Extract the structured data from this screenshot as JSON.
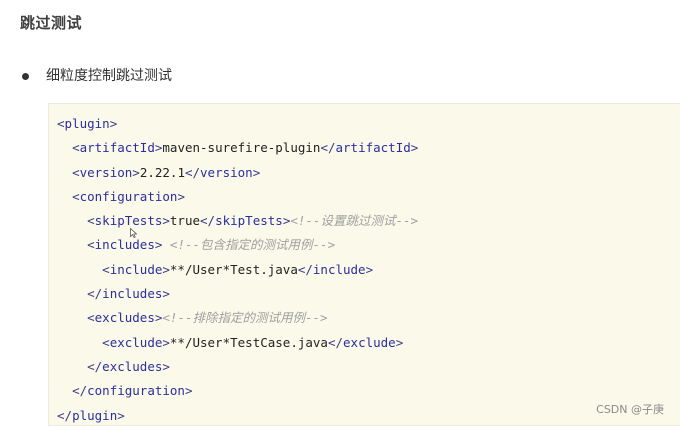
{
  "heading": "跳过测试",
  "bullet": {
    "text": "细粒度控制跳过测试"
  },
  "code": {
    "lines": [
      {
        "indent": "",
        "parts": [
          {
            "t": "tag",
            "v": "<"
          },
          {
            "t": "tagname",
            "v": "plugin"
          },
          {
            "t": "tag",
            "v": ">"
          }
        ]
      },
      {
        "indent": "  ",
        "parts": [
          {
            "t": "tag",
            "v": "<"
          },
          {
            "t": "tagname",
            "v": "artifactId"
          },
          {
            "t": "tag",
            "v": ">"
          },
          {
            "t": "text",
            "v": "maven-surefire-plugin"
          },
          {
            "t": "tag",
            "v": "</"
          },
          {
            "t": "tagname",
            "v": "artifactId"
          },
          {
            "t": "tag",
            "v": ">"
          }
        ]
      },
      {
        "indent": "  ",
        "parts": [
          {
            "t": "tag",
            "v": "<"
          },
          {
            "t": "tagname",
            "v": "version"
          },
          {
            "t": "tag",
            "v": ">"
          },
          {
            "t": "text",
            "v": "2.22.1"
          },
          {
            "t": "tag",
            "v": "</"
          },
          {
            "t": "tagname",
            "v": "version"
          },
          {
            "t": "tag",
            "v": ">"
          }
        ]
      },
      {
        "indent": "  ",
        "parts": [
          {
            "t": "tag",
            "v": "<"
          },
          {
            "t": "tagname",
            "v": "configuration"
          },
          {
            "t": "tag",
            "v": ">"
          }
        ]
      },
      {
        "indent": "    ",
        "parts": [
          {
            "t": "tag",
            "v": "<"
          },
          {
            "t": "tagname",
            "v": "skipTests"
          },
          {
            "t": "tag",
            "v": ">"
          },
          {
            "t": "text",
            "v": "true"
          },
          {
            "t": "tag",
            "v": "</"
          },
          {
            "t": "tagname",
            "v": "skipTests"
          },
          {
            "t": "tag",
            "v": ">"
          },
          {
            "t": "comment",
            "v": "<!--设置跳过测试-->"
          }
        ]
      },
      {
        "indent": "    ",
        "parts": [
          {
            "t": "tag",
            "v": "<"
          },
          {
            "t": "tagname",
            "v": "includes"
          },
          {
            "t": "tag",
            "v": ">"
          },
          {
            "t": "text",
            "v": " "
          },
          {
            "t": "comment",
            "v": "<!--包含指定的测试用例-->"
          }
        ]
      },
      {
        "indent": "      ",
        "parts": [
          {
            "t": "tag",
            "v": "<"
          },
          {
            "t": "tagname",
            "v": "include"
          },
          {
            "t": "tag",
            "v": ">"
          },
          {
            "t": "text",
            "v": "**/User*Test.java"
          },
          {
            "t": "tag",
            "v": "</"
          },
          {
            "t": "tagname",
            "v": "include"
          },
          {
            "t": "tag",
            "v": ">"
          }
        ]
      },
      {
        "indent": "    ",
        "parts": [
          {
            "t": "tag",
            "v": "</"
          },
          {
            "t": "tagname",
            "v": "includes"
          },
          {
            "t": "tag",
            "v": ">"
          }
        ]
      },
      {
        "indent": "    ",
        "parts": [
          {
            "t": "tag",
            "v": "<"
          },
          {
            "t": "tagname",
            "v": "excludes"
          },
          {
            "t": "tag",
            "v": ">"
          },
          {
            "t": "comment",
            "v": "<!--排除指定的测试用例-->"
          }
        ]
      },
      {
        "indent": "      ",
        "parts": [
          {
            "t": "tag",
            "v": "<"
          },
          {
            "t": "tagname",
            "v": "exclude"
          },
          {
            "t": "tag",
            "v": ">"
          },
          {
            "t": "text",
            "v": "**/User*TestCase.java"
          },
          {
            "t": "tag",
            "v": "</"
          },
          {
            "t": "tagname",
            "v": "exclude"
          },
          {
            "t": "tag",
            "v": ">"
          }
        ]
      },
      {
        "indent": "    ",
        "parts": [
          {
            "t": "tag",
            "v": "</"
          },
          {
            "t": "tagname",
            "v": "excludes"
          },
          {
            "t": "tag",
            "v": ">"
          }
        ]
      },
      {
        "indent": "  ",
        "parts": [
          {
            "t": "tag",
            "v": "</"
          },
          {
            "t": "tagname",
            "v": "configuration"
          },
          {
            "t": "tag",
            "v": ">"
          }
        ]
      },
      {
        "indent": "",
        "parts": [
          {
            "t": "tag",
            "v": "</"
          },
          {
            "t": "tagname",
            "v": "plugin"
          },
          {
            "t": "tag",
            "v": ">"
          }
        ]
      }
    ]
  },
  "watermark": "CSDN @子庚",
  "colors": {
    "code_background": "#fbf9e9",
    "tag_name": "#2a2f9c",
    "comment": "#a0a0a0"
  },
  "icons": {
    "cursor": "mouse-pointer-icon"
  }
}
